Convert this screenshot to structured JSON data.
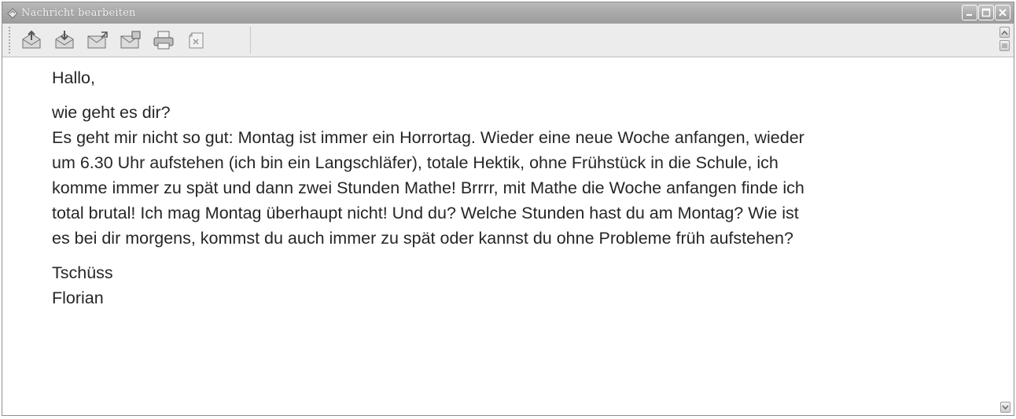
{
  "window": {
    "title": "Nachricht bearbeiten"
  },
  "toolbar": {
    "buttons": [
      {
        "icon": "send-mail-icon"
      },
      {
        "icon": "receive-mail-icon"
      },
      {
        "icon": "reply-icon"
      },
      {
        "icon": "forward-icon"
      },
      {
        "icon": "print-icon"
      },
      {
        "icon": "delete-icon"
      }
    ]
  },
  "message": {
    "greeting": "Hallo,",
    "lines": [
      "wie geht es dir?",
      "Es geht mir nicht so gut: Montag ist immer ein Horrortag. Wieder eine neue Woche anfangen, wieder",
      "um 6.30 Uhr aufstehen (ich bin ein Langschläfer), totale Hektik, ohne Frühstück in die Schule, ich",
      "komme immer zu spät und dann zwei Stunden Mathe! Brrrr, mit Mathe die Woche anfangen finde ich",
      "total brutal! Ich mag Montag überhaupt nicht! Und du? Welche Stunden hast du am Montag? Wie ist",
      "es bei dir morgens, kommst du auch immer zu spät oder kannst du ohne Probleme früh aufstehen?"
    ],
    "closing": "Tschüss",
    "signature": "Florian"
  },
  "colors": {
    "titlebar": "#a7a7a7",
    "toolbar": "#ececec",
    "text": "#262626"
  }
}
